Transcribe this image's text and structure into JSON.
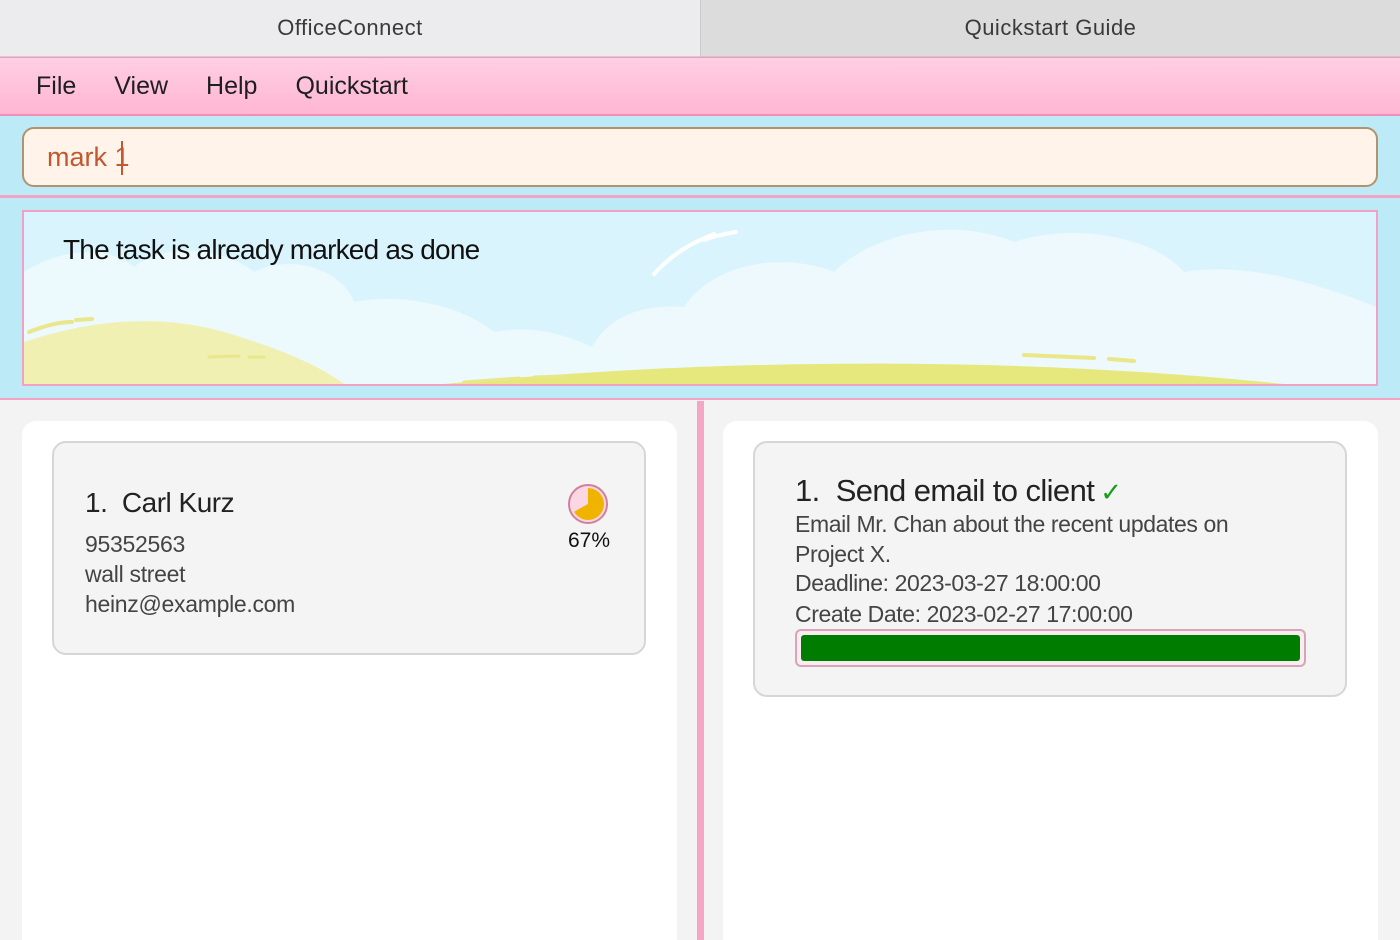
{
  "window": {
    "tabs": [
      {
        "label": "OfficeConnect",
        "active": true
      },
      {
        "label": "Quickstart Guide",
        "active": false
      }
    ]
  },
  "menu": {
    "items": [
      "File",
      "View",
      "Help",
      "Quickstart"
    ]
  },
  "command": {
    "value": "mark 1"
  },
  "result": {
    "message": "The task is already marked as done"
  },
  "persons": [
    {
      "index": "1.",
      "name": "Carl Kurz",
      "phone": "95352563",
      "address": "wall street",
      "email": "heinz@example.com",
      "progress_label": "67%",
      "progress_fraction": 0.67
    }
  ],
  "tasks": [
    {
      "index": "1.",
      "title": "Send email to client",
      "done_mark": "✓",
      "description_line1": "Email Mr. Chan about the recent updates on",
      "description_line2": "Project X.",
      "deadline": "Deadline: 2023-03-27 18:00:00",
      "create_date": "Create Date: 2023-02-27 17:00:00",
      "progress_fraction": 1.0
    }
  ],
  "colors": {
    "accent_pink": "#f4a6c4",
    "command_text": "#c1582f",
    "progress_green": "#007d00",
    "pie_fill": "#f0b400",
    "check_green": "#14a014"
  }
}
